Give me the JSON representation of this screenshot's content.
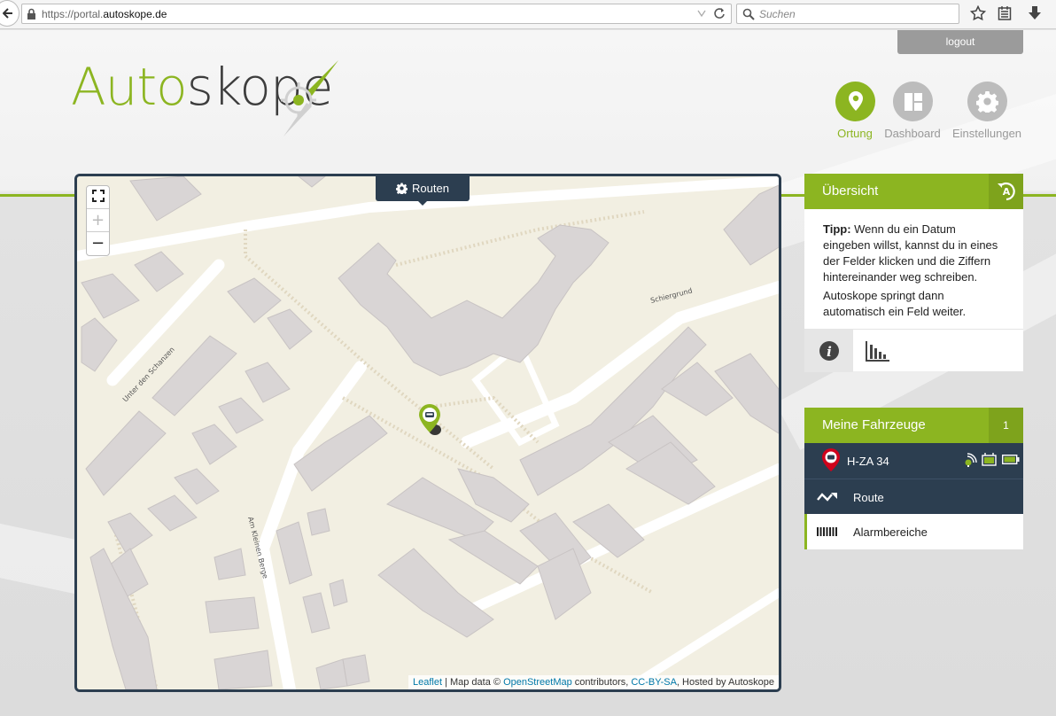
{
  "browser": {
    "url_prefix": "https://portal.",
    "url_domain": "autoskope.de",
    "search_placeholder": "Suchen"
  },
  "header": {
    "logout_label": "logout",
    "logo_part1": "Auto",
    "logo_part2": "skope"
  },
  "nav": {
    "items": [
      {
        "label": "Ortung",
        "active": true
      },
      {
        "label": "Dashboard",
        "active": false
      },
      {
        "label": "Einstellungen",
        "active": false
      }
    ]
  },
  "map": {
    "routes_label": "Routen",
    "zoom_in": "+",
    "zoom_out": "−",
    "street_labels": [
      "Schiergrund",
      "Unter den Schanzen",
      "Am Kleinen Berge"
    ],
    "attribution": {
      "leaflet": "Leaflet",
      "sep1": " | Map data © ",
      "osm": "OpenStreetMap",
      "sep2": " contributors, ",
      "license": "CC-BY-SA",
      "hosted": ", Hosted by Autoskope"
    }
  },
  "overview": {
    "title": "Übersicht",
    "tip_label": "Tipp:",
    "tip_text": " Wenn du ein Datum eingeben willst, kannst du in eines der Felder klicken und die Ziffern hintereinander weg schreiben.",
    "tip_text2": "Autoskope springt dann automatisch ein Feld weiter."
  },
  "vehicles": {
    "title": "Meine Fahrzeuge",
    "count": "1",
    "vehicle_name": "H-ZA 34",
    "menu": [
      {
        "label": "Route",
        "icon": "route-icon",
        "active": true
      },
      {
        "label": "Alarmbereiche",
        "icon": "alarm-zone-icon",
        "active": false
      }
    ]
  },
  "colors": {
    "accent": "#8cb521",
    "dark": "#2c3e50"
  }
}
